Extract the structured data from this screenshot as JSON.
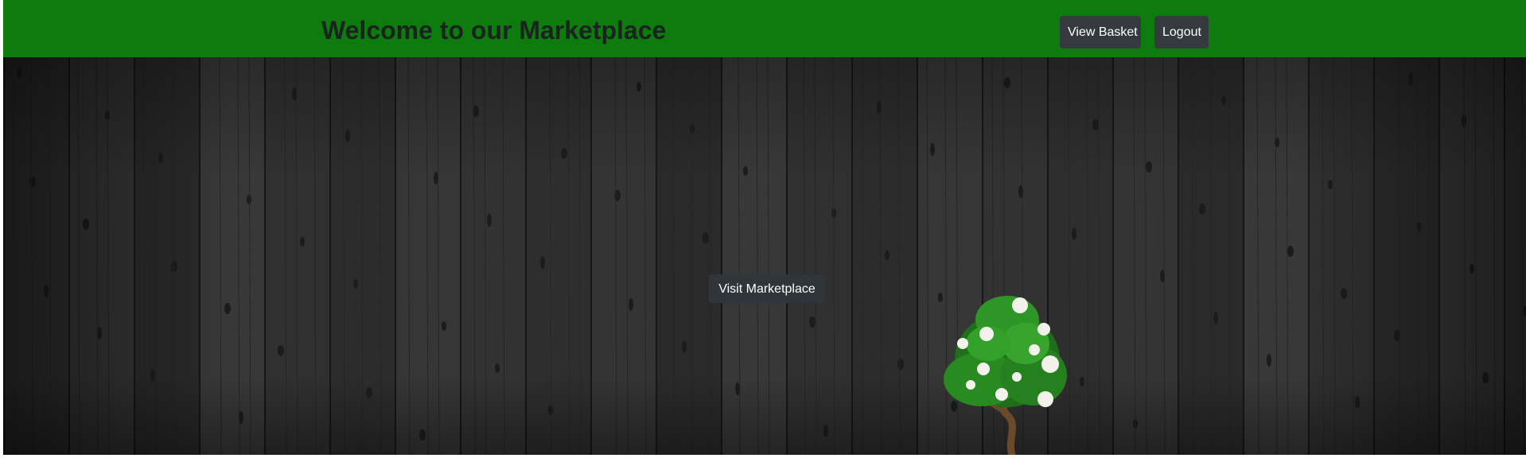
{
  "header": {
    "title": "Welcome to our Marketplace",
    "view_basket_label": "View Basket",
    "logout_label": "Logout"
  },
  "hero": {
    "visit_button_label": "Visit Marketplace",
    "background": "dark wooden planks"
  },
  "colors": {
    "navbar": "#0e7b0e",
    "button": "#343a40",
    "title_text": "#1a2320",
    "button_text": "#ffffff"
  },
  "icons": {
    "decoration": "flowering-bonsai-tree"
  }
}
